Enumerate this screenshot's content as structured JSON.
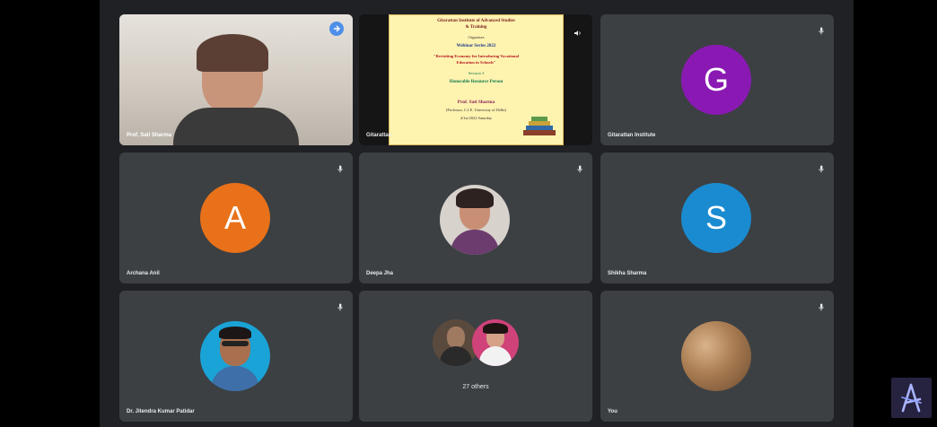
{
  "participants": {
    "tile1_name": "Prof. Sati Sharma",
    "tile2_name": "Gitarattan",
    "tile3_name": "Gitarattan Institute",
    "tile4_name": "Archana Anil",
    "tile5_name": "Deepa Jha",
    "tile6_name": "Shikha Sharma",
    "tile7_name": "Dr. Jitendra Kumar Patidar",
    "tile8_name": "27 others",
    "tile9_name": "You"
  },
  "avatars": {
    "tile3_initial": "G",
    "tile4_initial": "A",
    "tile6_initial": "S"
  },
  "poster": {
    "line1": "Gitarattan Institute of Advanced Studies",
    "line2": "& Training",
    "line3": "Organises",
    "line4": "Webinar Series 2022",
    "line5": "\"Revisiting Economy for Introducing Vocational",
    "line6": "Education in Schools\"",
    "line7": "Session 3",
    "line8": "Honorable Resource Person",
    "line9": "Prof. Sati Sharma",
    "line10": "(Professor, C.I.E. University of Delhi)",
    "line11": "4/1st/2022 Saturday"
  },
  "colors": {
    "tile_bg": "#3c4043",
    "stage_bg": "#1f2125",
    "avatar_g": "#8a19b3",
    "avatar_a": "#e8711a",
    "avatar_s": "#1a8bd0",
    "pin": "#4f8fe8"
  },
  "icons": {
    "mic": "mic-off-icon",
    "pin": "pin-icon",
    "volume": "volume-icon",
    "logo": "app-logo-icon"
  }
}
